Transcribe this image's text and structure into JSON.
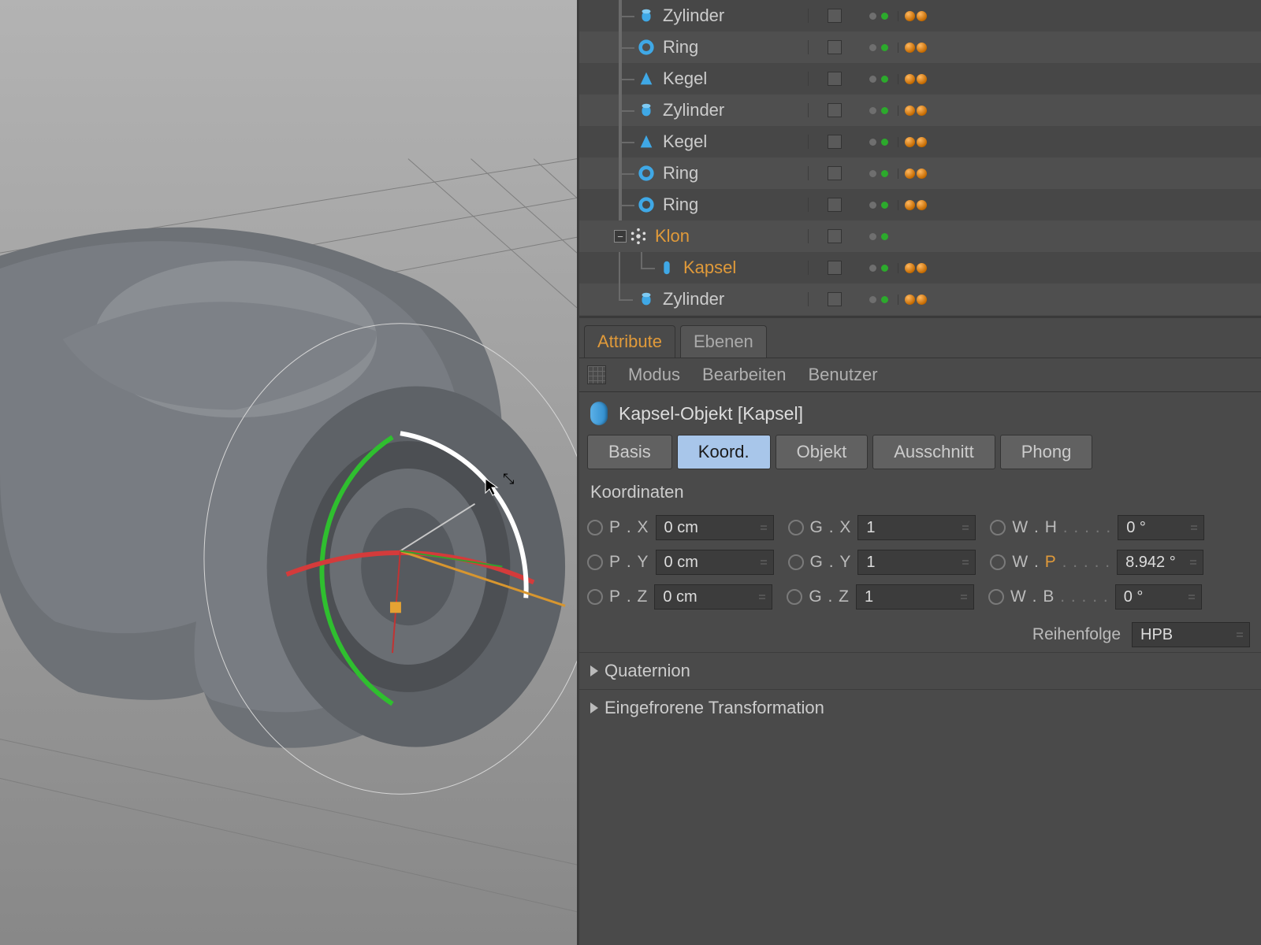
{
  "hierarchy": {
    "rows": [
      {
        "label": "Zylinder",
        "type": "cyl",
        "indent": 80,
        "tree": "elbow-thru",
        "selected": false,
        "tags": 2
      },
      {
        "label": "Ring",
        "type": "ring",
        "indent": 80,
        "tree": "elbow-thru",
        "selected": false,
        "tags": 2
      },
      {
        "label": "Kegel",
        "type": "cone",
        "indent": 80,
        "tree": "elbow-thru",
        "selected": false,
        "tags": 2
      },
      {
        "label": "Zylinder",
        "type": "cyl",
        "indent": 80,
        "tree": "elbow-thru",
        "selected": false,
        "tags": 2
      },
      {
        "label": "Kegel",
        "type": "cone",
        "indent": 80,
        "tree": "elbow-thru",
        "selected": false,
        "tags": 2
      },
      {
        "label": "Ring",
        "type": "ring",
        "indent": 80,
        "tree": "elbow-thru",
        "selected": false,
        "tags": 2
      },
      {
        "label": "Ring",
        "type": "ring",
        "indent": 80,
        "tree": "elbow-thru",
        "selected": false,
        "tags": 2
      },
      {
        "label": "Klon",
        "type": "klon",
        "indent": 80,
        "tree": "elbow-thru",
        "selected": true,
        "expand": "-",
        "tags": 0
      },
      {
        "label": "Kapsel",
        "type": "capsule",
        "indent": 110,
        "tree": "child-end",
        "selected": true,
        "tags": 2
      },
      {
        "label": "Zylinder",
        "type": "cyl",
        "indent": 80,
        "tree": "elbow",
        "selected": false,
        "tags": 2
      }
    ]
  },
  "colors": {
    "cyl": "#3fa8e6",
    "ring": "#3fa8e6",
    "cone": "#3fa8e6",
    "capsule": "#3fa8e6"
  },
  "tabs": {
    "attribute": "Attribute",
    "ebenen": "Ebenen",
    "menus": [
      "Modus",
      "Bearbeiten",
      "Benutzer"
    ]
  },
  "object_header": "Kapsel-Objekt [Kapsel]",
  "tabs2": [
    "Basis",
    "Koord.",
    "Objekt",
    "Ausschnitt",
    "Phong"
  ],
  "tabs2_active": 1,
  "section": "Koordinaten",
  "coords": {
    "P": {
      "X": "0 cm",
      "Y": "0 cm",
      "Z": "0 cm"
    },
    "G": {
      "X": "1",
      "Y": "1",
      "Z": "1"
    },
    "W": {
      "H": "0 °",
      "P": "8.942 °",
      "B": "0 °"
    }
  },
  "order_label": "Reihenfolge",
  "order_value": "HPB",
  "folds": [
    "Quaternion",
    "Eingefrorene Transformation"
  ]
}
